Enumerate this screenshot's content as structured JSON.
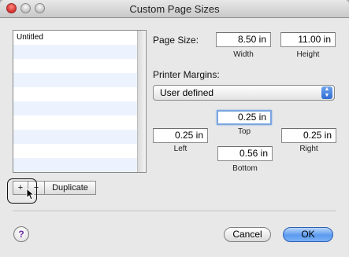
{
  "window": {
    "title": "Custom Page Sizes"
  },
  "list": {
    "items": [
      "Untitled"
    ]
  },
  "list_controls": {
    "add_label": "+",
    "remove_label": "−",
    "duplicate_label": "Duplicate"
  },
  "page_size": {
    "label": "Page Size:",
    "width_value": "8.50 in",
    "width_label": "Width",
    "height_value": "11.00 in",
    "height_label": "Height"
  },
  "margins": {
    "label": "Printer Margins:",
    "preset_selected": "User defined",
    "top_value": "0.25 in",
    "top_label": "Top",
    "left_value": "0.25 in",
    "left_label": "Left",
    "right_value": "0.25 in",
    "right_label": "Right",
    "bottom_value": "0.56 in",
    "bottom_label": "Bottom"
  },
  "buttons": {
    "help_label": "?",
    "cancel_label": "Cancel",
    "ok_label": "OK"
  },
  "colors": {
    "accent": "#5b9af0",
    "focus_ring": "#7aa6e0",
    "list_stripe": "#edf3fe"
  }
}
